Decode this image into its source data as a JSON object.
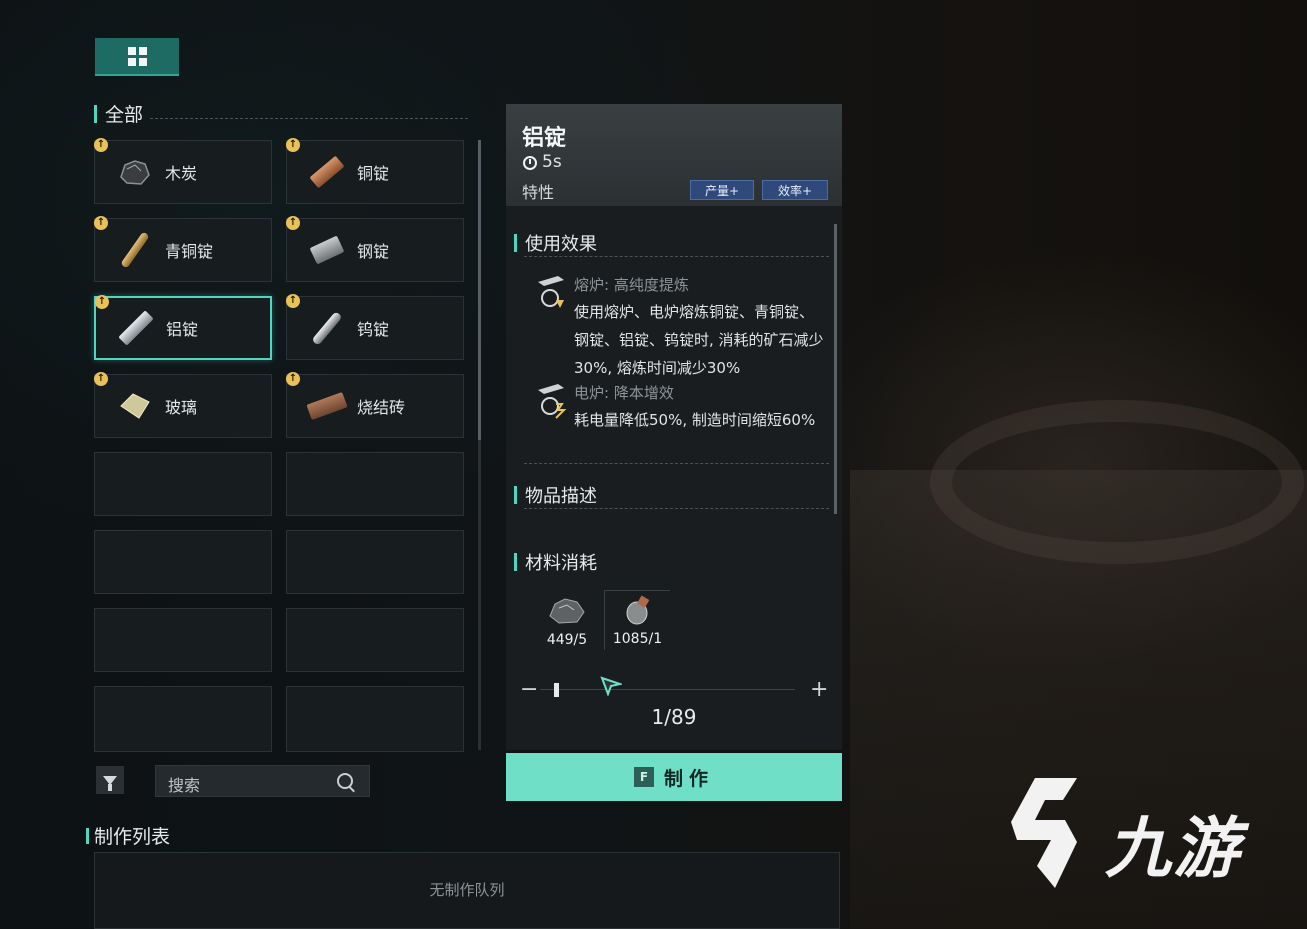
{
  "category_tab": {
    "icon": "grid-icon"
  },
  "list_section": {
    "label": "全部"
  },
  "items": [
    {
      "name": "木炭",
      "icon": "charcoal-icon",
      "selected": false
    },
    {
      "name": "铜锭",
      "icon": "copper-ingot-icon",
      "selected": false
    },
    {
      "name": "青铜锭",
      "icon": "bronze-ingot-icon",
      "selected": false
    },
    {
      "name": "钢锭",
      "icon": "steel-ingot-icon",
      "selected": false
    },
    {
      "name": "铝锭",
      "icon": "aluminum-ingot-icon",
      "selected": true
    },
    {
      "name": "钨锭",
      "icon": "tungsten-ingot-icon",
      "selected": false
    },
    {
      "name": "玻璃",
      "icon": "glass-icon",
      "selected": false
    },
    {
      "name": "烧结砖",
      "icon": "brick-icon",
      "selected": false
    }
  ],
  "search": {
    "placeholder": "搜索"
  },
  "queue": {
    "label": "制作列表",
    "empty_text": "无制作队列"
  },
  "detail": {
    "title": "铝锭",
    "time": "5s",
    "trait_label": "特性",
    "tags": [
      "产量+",
      "效率+"
    ],
    "effects_label": "使用效果",
    "effects": [
      {
        "head": "熔炉: 高纯度提炼",
        "body": "使用熔炉、电炉熔炼铜锭、青铜锭、钢锭、铝锭、钨锭时, 消耗的矿石减少30%, 熔炼时间减少30%"
      },
      {
        "head": "电炉: 降本增效",
        "body": "耗电量降低50%, 制造时间缩短60%"
      }
    ],
    "description_label": "物品描述",
    "materials_label": "材料消耗",
    "materials": [
      {
        "count": "449/5",
        "icon": "ore-icon"
      },
      {
        "count": "1085/1",
        "icon": "fuel-icon"
      }
    ],
    "quantity": "1/89",
    "slider_minus": "−",
    "slider_plus": "+",
    "craft_key": "F",
    "craft_label": "制作"
  },
  "watermark": {
    "text": "九游"
  },
  "colors": {
    "accent": "#4fd5c0",
    "craft_button": "#6fe0c7",
    "tag_bg": "#2f4a7a",
    "badge": "#e9c257"
  }
}
